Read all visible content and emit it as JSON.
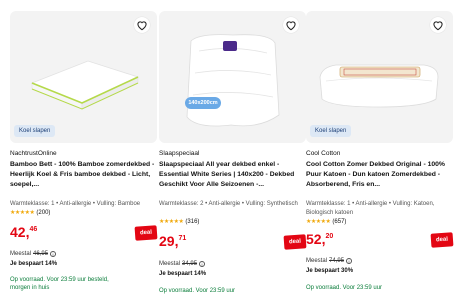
{
  "products": [
    {
      "kenmerk": "Koel slapen",
      "brand": "NachtrustOnline",
      "title": "Bamboo Bett - 100% Bamboe zomerdekbed - Heerlijk Koel & Fris bamboe dekbed - Licht, soepel,...",
      "spec": "Warmteklasse: 1 • Anti-allergie • Vulling: Bamboe",
      "stars": "★★★★★",
      "reviews": "(200)",
      "price_whole": "42,",
      "price_cents": "46",
      "deal": "deal",
      "meest_label": "Meestal",
      "meest_price": "46,95",
      "bespaart": "Je bespaart 14%",
      "delivery": "Op voorraad. Voor 23:59 uur besteld, morgen in huis"
    },
    {
      "badge": "140x200cm",
      "brand": "Slaapspeciaal",
      "title": "Slaapspeciaal All year dekbed enkel - Essential White Series | 140x200 - Dekbed Geschikt Voor Alle Seizoenen -...",
      "spec": "Warmteklasse: 2 • Anti-allergie • Vulling: Synthetisch",
      "stars": "★★★★★",
      "reviews": "(316)",
      "price_whole": "29,",
      "price_cents": "71",
      "deal": "deal",
      "meest_label": "Meestal",
      "meest_price": "34,95",
      "bespaart": "Je bespaart 14%",
      "delivery": "Op voorraad. Voor 23:59 uur"
    },
    {
      "kenmerk": "Koel slapen",
      "brand": "Cool Cotton",
      "title": "Cool Cotton Zomer Dekbed Original - 100% Puur Katoen - Dun katoen Zomerdekbed - Absorberend, Fris en...",
      "spec": "Warmteklasse: 1 • Anti-allergie • Vulling: Katoen, Biologisch katoen",
      "stars": "★★★★★",
      "reviews": "(657)",
      "price_whole": "52,",
      "price_cents": "20",
      "deal": "deal",
      "meest_label": "Meestal",
      "meest_price": "74,95",
      "bespaart": "Je bespaart 30%",
      "delivery": "Op voorraad. Voor 23:59 uur"
    }
  ],
  "colors": {
    "deal_red": "#e30613",
    "delivery_green": "#0a7d3a",
    "star": "#f0a90d",
    "badge_blue": "#6aa9e6"
  }
}
